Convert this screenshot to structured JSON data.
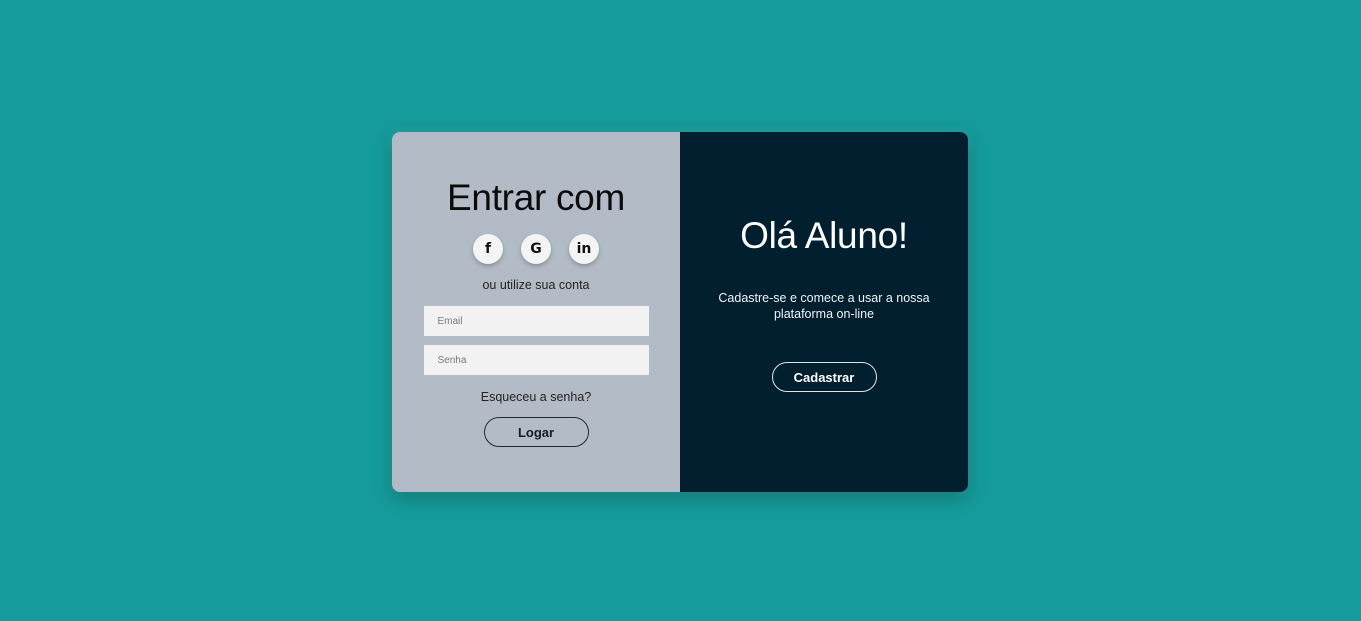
{
  "colors": {
    "background": "#159b9b",
    "left_panel": "#b3bcc6",
    "right_panel": "#021f2f",
    "input_bg": "#f2f2f2"
  },
  "login": {
    "title": "Entrar com",
    "socials": [
      {
        "icon": "facebook-icon",
        "glyph": "f"
      },
      {
        "icon": "google-icon",
        "glyph": "G"
      },
      {
        "icon": "linkedin-icon",
        "glyph": "in"
      }
    ],
    "alt_text": "ou utilize sua conta",
    "email_placeholder": "Email",
    "password_placeholder": "Senha",
    "forgot": "Esqueceu a senha?",
    "submit_label": "Logar"
  },
  "welcome": {
    "title": "Olá Aluno!",
    "description": "Cadastre-se e comece a usar a nossa plataforma on-line",
    "register_label": "Cadastrar"
  }
}
